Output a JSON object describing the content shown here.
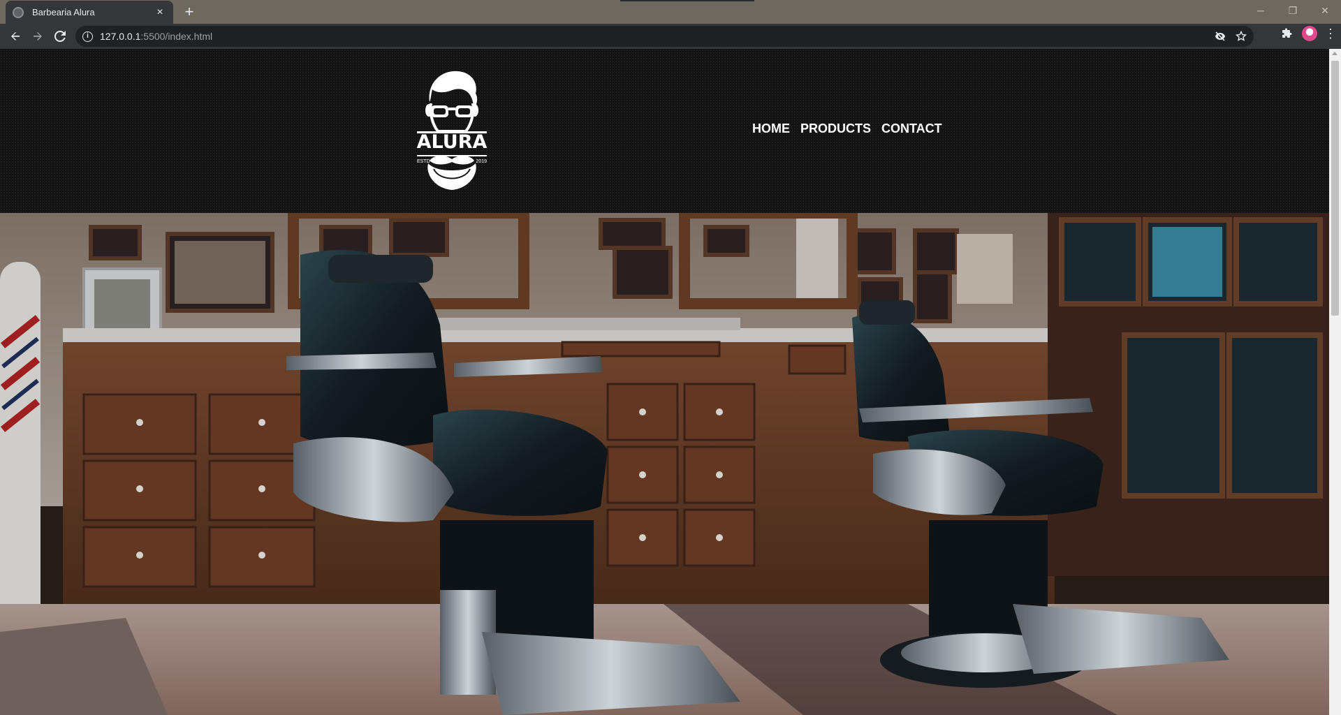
{
  "browser": {
    "tab_title": "Barbearia Alura",
    "tab_close": "×",
    "new_tab": "+",
    "url_host": "127.0.0.1",
    "url_path": ":5500/index.html",
    "window_controls": {
      "minimize": "─",
      "restore": "❐",
      "close": "✕"
    }
  },
  "header": {
    "logo": {
      "name": "ALURA",
      "estd": "ESTD",
      "year": "2019"
    },
    "nav": [
      {
        "label": "HOME"
      },
      {
        "label": "PRODUCTS"
      },
      {
        "label": "CONTACT"
      }
    ]
  },
  "hero": {
    "image_description": "barbershop-interior-photo"
  },
  "colors": {
    "header_bg": "#161616",
    "nav_text": "#ffffff",
    "chrome_tabbar": "#6e695e",
    "chrome_toolbar": "#35363a"
  }
}
